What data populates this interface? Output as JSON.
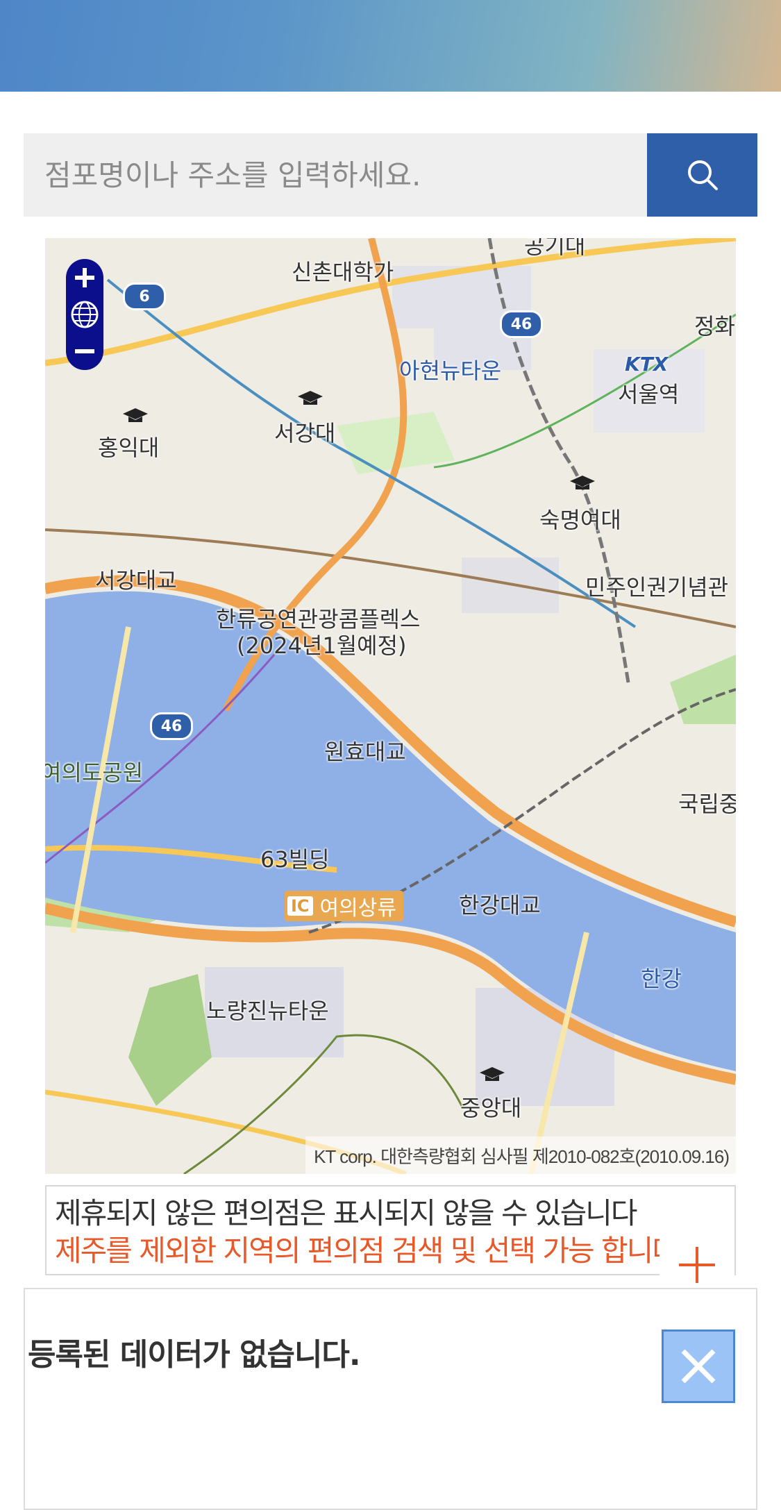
{
  "search": {
    "placeholder": "점포명이나 주소를 입력하세요."
  },
  "map": {
    "labels": {
      "sinchon": "신촌대학가",
      "ahyeon": "아현뉴타운",
      "seoul_station": "서울역",
      "hongik": "홍익대",
      "sogang": "서강대",
      "sookmyung": "숙명여대",
      "sogang_bridge": "서강대교",
      "democracy_memorial": "민주인권기념관",
      "hallyu_line1": "한류공연관광콤플렉스",
      "hallyu_line2": "(2024년1월예정)",
      "wonhyo_bridge": "원효대교",
      "yeouido_park": "여의도공원",
      "national": "국립중",
      "building63": "63빌딩",
      "ic": "IC",
      "yeouisangryu": "여의상류",
      "hangang_bridge": "한강대교",
      "hangang": "한강",
      "noryangjin": "노량진뉴타운",
      "chungang": "중앙대",
      "top_cut": "공기대",
      "jeonghwa": "정화",
      "ktx": "KTX"
    },
    "shields": [
      "6",
      "46",
      "46"
    ],
    "copyright": "KT corp. 대한측량협회 심사필 제2010-082호(2010.09.16)"
  },
  "notice": {
    "line1": "제휴되지 않은 편의점은 표시되지 않을 수 있습니다",
    "line2": "제주를 제외한 지역의 편의점 검색 및 선택 가능 합니다"
  },
  "results": {
    "empty_message": "등록된 데이터가 없습니다."
  },
  "colors": {
    "accent_blue": "#2f5fa8",
    "notice_orange": "#e8592a",
    "river": "#8fb0e6"
  }
}
